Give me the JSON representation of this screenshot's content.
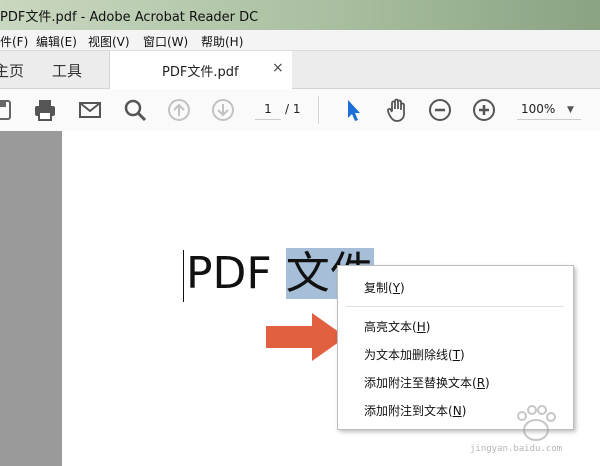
{
  "window": {
    "title": "PDF文件.pdf - Adobe Acrobat Reader DC"
  },
  "menubar": {
    "items": [
      {
        "label": "件(F)"
      },
      {
        "label": "编辑(E)"
      },
      {
        "label": "视图(V)"
      },
      {
        "label": "窗口(W)"
      },
      {
        "label": "帮助(H)"
      }
    ]
  },
  "tabs": {
    "home": "主页",
    "tools": "工具",
    "document": "PDF文件.pdf",
    "close_glyph": "×"
  },
  "toolbar": {
    "page_current": "1",
    "page_total": "/ 1",
    "zoom": "100%",
    "zoom_caret": "▼",
    "icons": [
      "save-icon",
      "print-icon",
      "mail-icon",
      "search-icon",
      "prev-page-icon",
      "next-page-icon",
      "select-arrow-icon",
      "hand-tool-icon",
      "zoom-out-icon",
      "zoom-in-icon"
    ],
    "accent_color": "#1c6fd6"
  },
  "document": {
    "text_plain": "PDF ",
    "text_selected": "文件",
    "selection_color": "#a6bed8"
  },
  "context_menu": {
    "items": [
      {
        "label": "复制",
        "key": "Y"
      },
      {
        "label": "高亮文本",
        "key": "H"
      },
      {
        "label": "为文本加删除线",
        "key": "T"
      },
      {
        "label": "添加附注至替换文本",
        "key": "R"
      },
      {
        "label": "添加附注到文本",
        "key": "N"
      }
    ]
  },
  "annotation_arrow": {
    "color": "#e0603f"
  },
  "watermark": {
    "text": "jingyan.baidu.com"
  }
}
